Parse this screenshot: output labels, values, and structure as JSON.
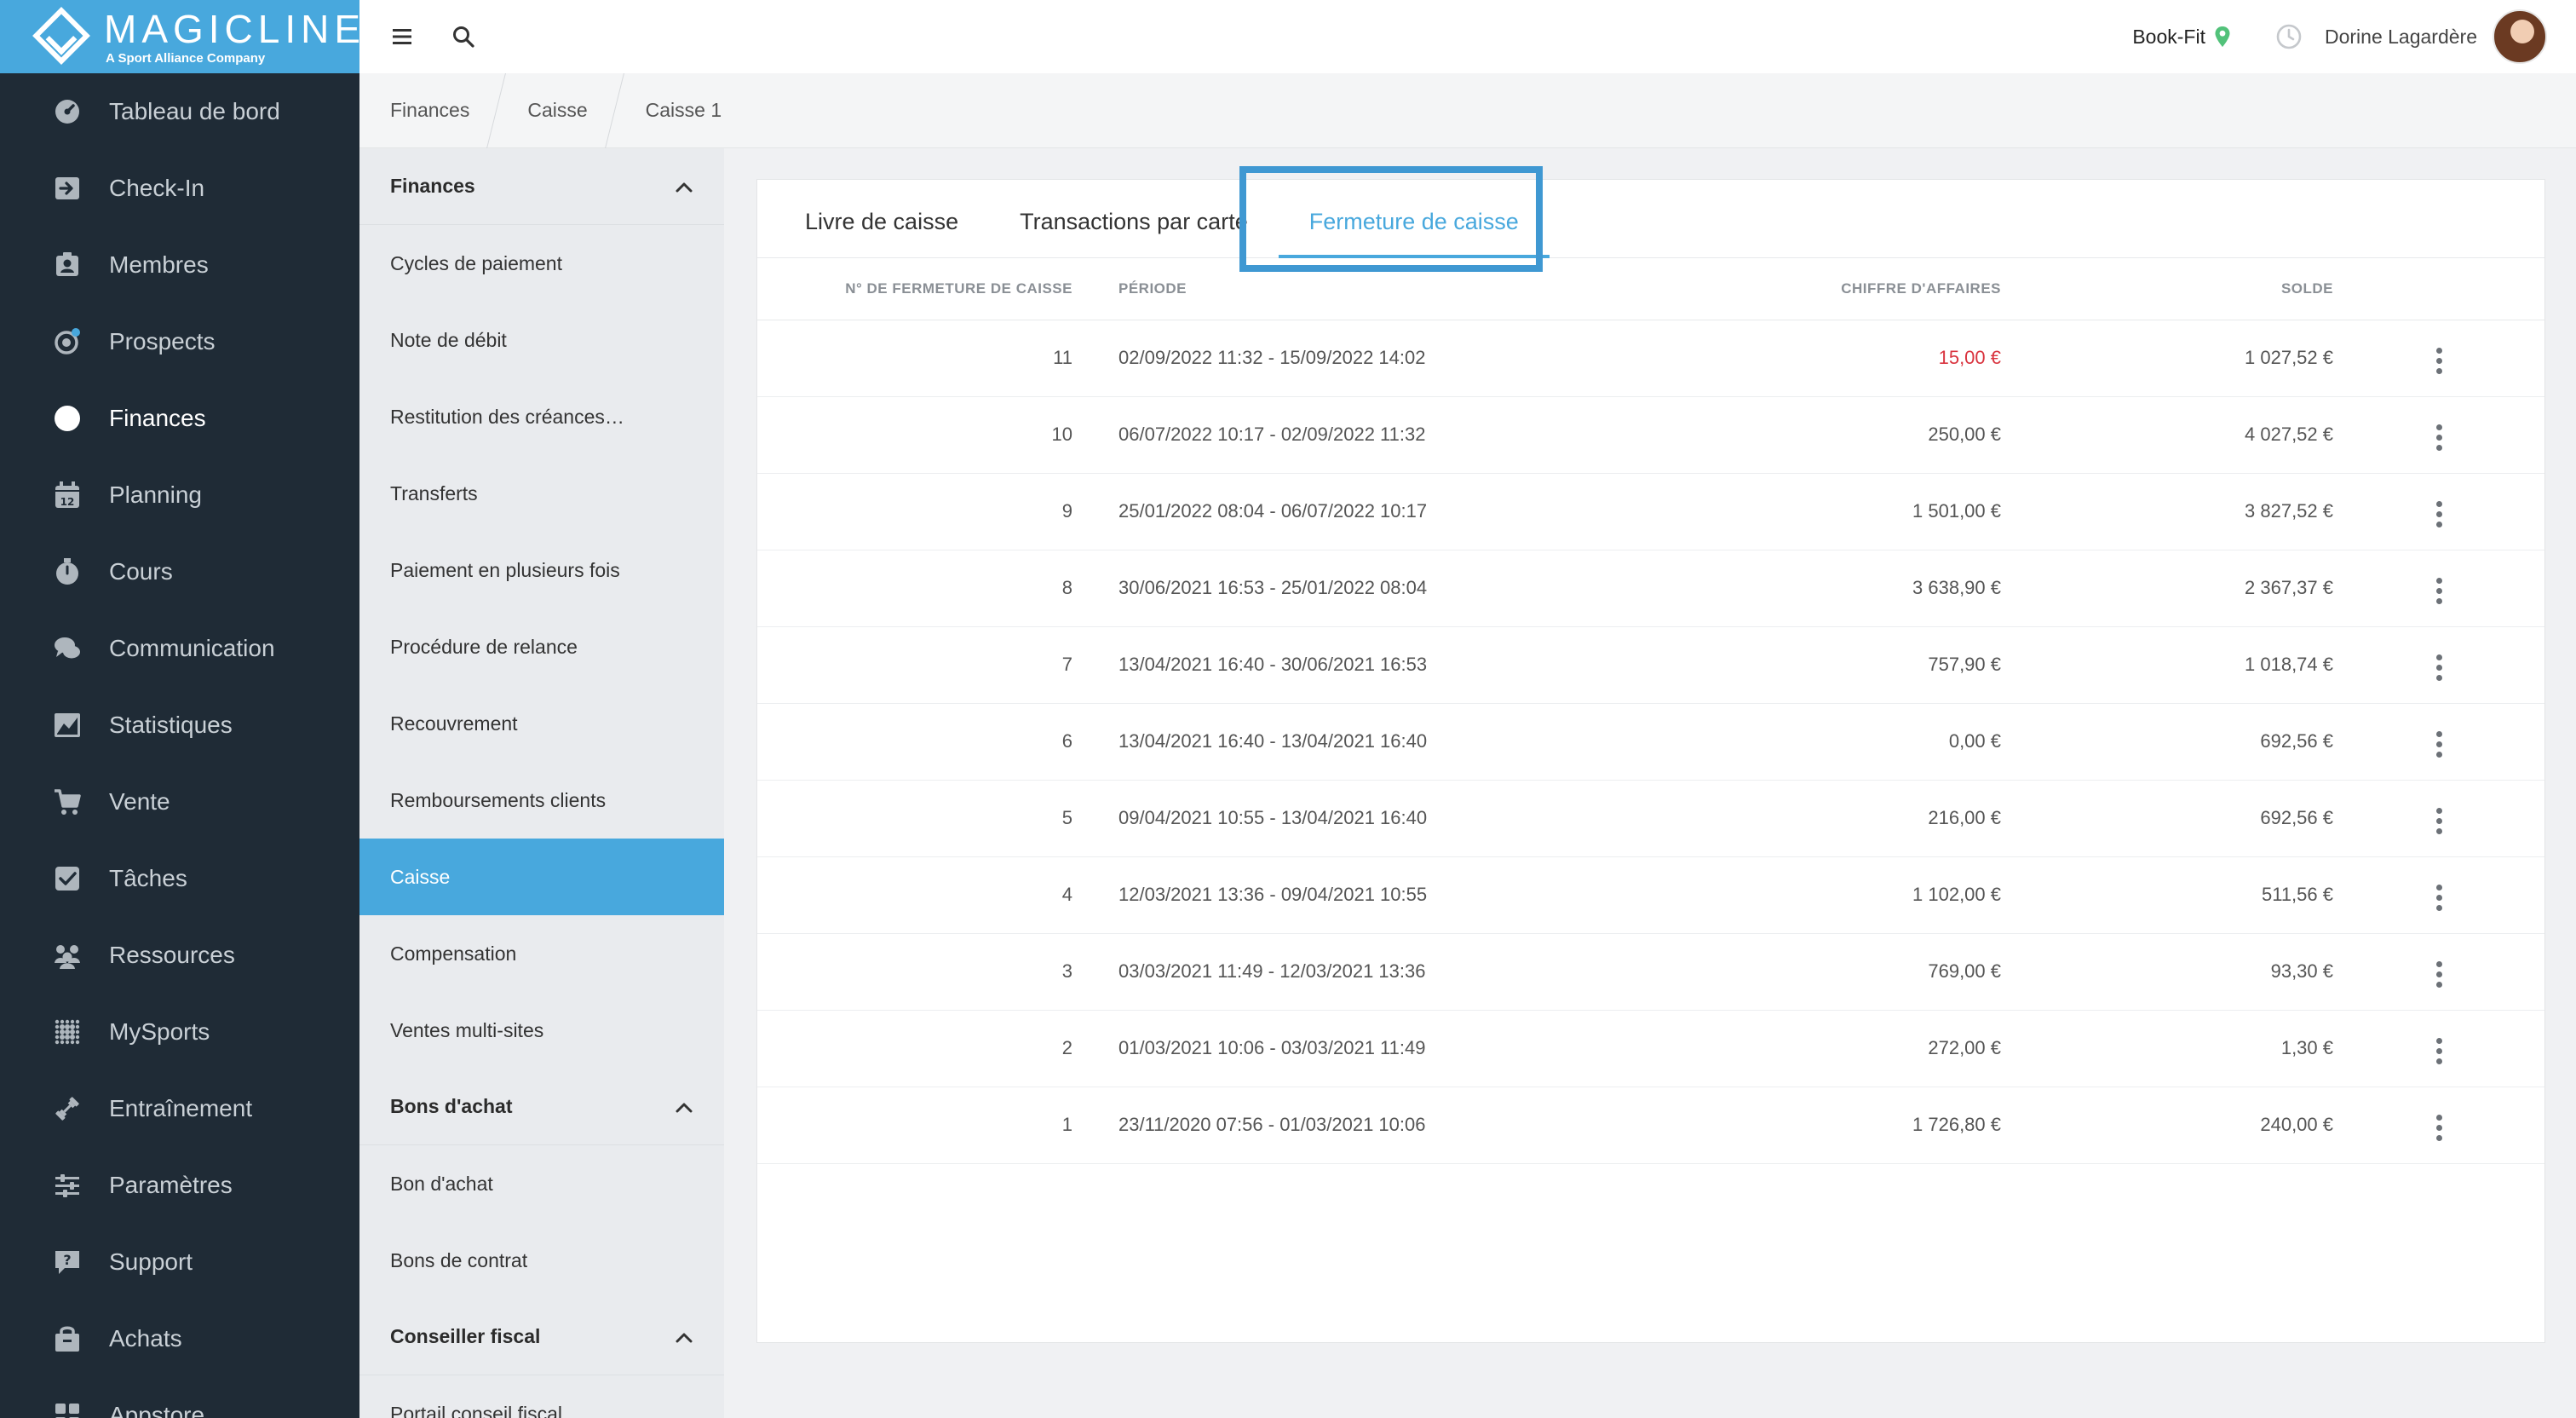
{
  "brand": {
    "name": "MAGICLINE",
    "tagline": "A Sport Alliance Company"
  },
  "nav": {
    "items": [
      {
        "label": "Tableau de bord",
        "icon": "dashboard-icon"
      },
      {
        "label": "Check-In",
        "icon": "check-in-icon"
      },
      {
        "label": "Membres",
        "icon": "members-icon"
      },
      {
        "label": "Prospects",
        "icon": "prospects-icon"
      },
      {
        "label": "Finances",
        "icon": "euro-icon",
        "active": true
      },
      {
        "label": "Planning",
        "icon": "calendar-icon",
        "badge": "12"
      },
      {
        "label": "Cours",
        "icon": "stopwatch-icon"
      },
      {
        "label": "Communication",
        "icon": "chat-icon"
      },
      {
        "label": "Statistiques",
        "icon": "chart-icon"
      },
      {
        "label": "Vente",
        "icon": "cart-icon"
      },
      {
        "label": "Tâches",
        "icon": "task-check-icon"
      },
      {
        "label": "Ressources",
        "icon": "resources-icon"
      },
      {
        "label": "MySports",
        "icon": "mysports-icon"
      },
      {
        "label": "Entraînement",
        "icon": "dumbbell-icon"
      },
      {
        "label": "Paramètres",
        "icon": "sliders-icon"
      },
      {
        "label": "Support",
        "icon": "support-icon"
      },
      {
        "label": "Achats",
        "icon": "purchases-icon"
      },
      {
        "label": "Appstore",
        "icon": "appstore-icon"
      }
    ]
  },
  "topbar": {
    "studio": "Book-Fit",
    "user": "Dorine Lagardère"
  },
  "breadcrumb": [
    "Finances",
    "Caisse",
    "Caisse 1"
  ],
  "subnav": {
    "sections": [
      {
        "title": "Finances",
        "items": [
          "Cycles de paiement",
          "Note de débit",
          "Restitution des créances…",
          "Transferts",
          "Paiement en plusieurs fois",
          "Procédure de relance",
          "Recouvrement",
          "Remboursements clients",
          "Caisse",
          "Compensation",
          "Ventes multi-sites"
        ]
      },
      {
        "title": "Bons d'achat",
        "items": [
          "Bon d'achat",
          "Bons de contrat"
        ]
      },
      {
        "title": "Conseiller fiscal",
        "items": [
          "Portail conseil fiscal"
        ]
      }
    ],
    "active_item": "Caisse"
  },
  "tabs": [
    "Livre de caisse",
    "Transactions par carte",
    "Fermeture de caisse"
  ],
  "active_tab": "Fermeture de caisse",
  "table": {
    "headers": [
      "N° de fermeture de caisse",
      "Période",
      "Chiffre d'affaires",
      "Solde"
    ],
    "rows": [
      {
        "num": "11",
        "periode": "02/09/2022 11:32 - 15/09/2022 14:02",
        "ca": "15,00 €",
        "solde": "1 027,52 €",
        "ca_red": true
      },
      {
        "num": "10",
        "periode": "06/07/2022 10:17 - 02/09/2022 11:32",
        "ca": "250,00 €",
        "solde": "4 027,52 €"
      },
      {
        "num": "9",
        "periode": "25/01/2022 08:04 - 06/07/2022 10:17",
        "ca": "1 501,00 €",
        "solde": "3 827,52 €"
      },
      {
        "num": "8",
        "periode": "30/06/2021 16:53 - 25/01/2022 08:04",
        "ca": "3 638,90 €",
        "solde": "2 367,37 €"
      },
      {
        "num": "7",
        "periode": "13/04/2021 16:40 - 30/06/2021 16:53",
        "ca": "757,90 €",
        "solde": "1 018,74 €"
      },
      {
        "num": "6",
        "periode": "13/04/2021 16:40 - 13/04/2021 16:40",
        "ca": "0,00 €",
        "solde": "692,56 €"
      },
      {
        "num": "5",
        "periode": "09/04/2021 10:55 - 13/04/2021 16:40",
        "ca": "216,00 €",
        "solde": "692,56 €"
      },
      {
        "num": "4",
        "periode": "12/03/2021 13:36 - 09/04/2021 10:55",
        "ca": "1 102,00 €",
        "solde": "511,56 €"
      },
      {
        "num": "3",
        "periode": "03/03/2021 11:49 - 12/03/2021 13:36",
        "ca": "769,00 €",
        "solde": "93,30 €"
      },
      {
        "num": "2",
        "periode": "01/03/2021 10:06 - 03/03/2021 11:49",
        "ca": "272,00 €",
        "solde": "1,30 €"
      },
      {
        "num": "1",
        "periode": "23/11/2020 07:56 - 01/03/2021 10:06",
        "ca": "1 726,80 €",
        "solde": "240,00 €"
      }
    ]
  },
  "colors": {
    "accent": "#48a8dd",
    "nav_bg": "#1f2b36",
    "negative": "#d9343f",
    "highlight_frame": "#3f98d2"
  }
}
